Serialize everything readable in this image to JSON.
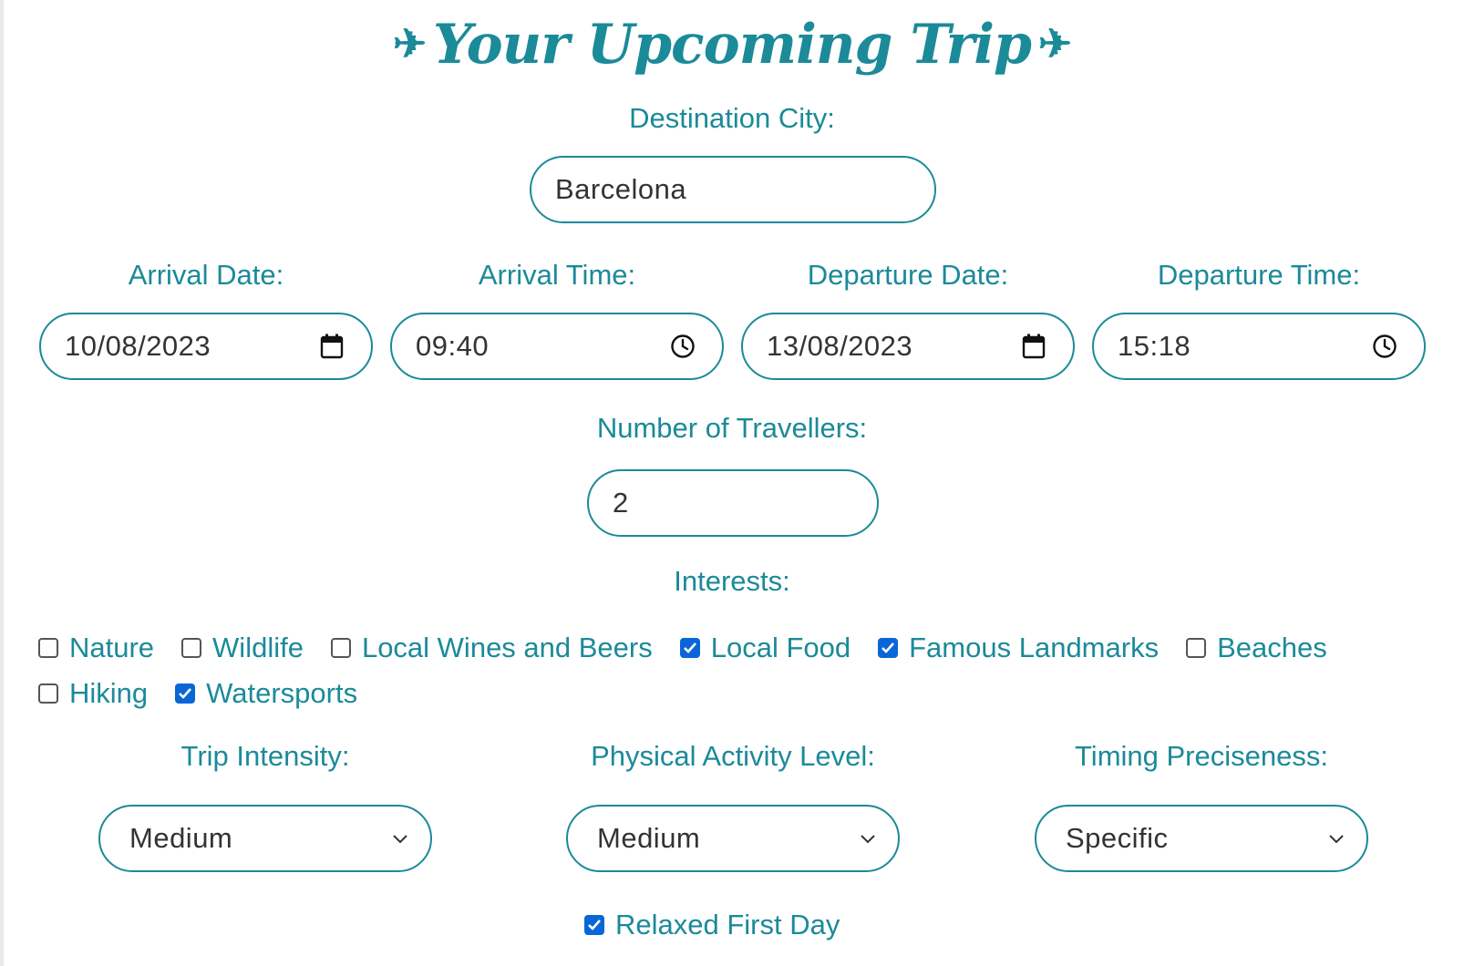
{
  "header": {
    "title": "Your Upcoming Trip",
    "plane_glyph": "✈"
  },
  "destination": {
    "label": "Destination City:",
    "value": "Barcelona"
  },
  "arrival_date": {
    "label": "Arrival Date:",
    "value": "10/08/2023"
  },
  "arrival_time": {
    "label": "Arrival Time:",
    "value": "09:40"
  },
  "departure_date": {
    "label": "Departure Date:",
    "value": "13/08/2023"
  },
  "departure_time": {
    "label": "Departure Time:",
    "value": "15:18"
  },
  "travellers": {
    "label": "Number of Travellers:",
    "value": "2"
  },
  "interests": {
    "label": "Interests:",
    "items": [
      {
        "label": "Nature",
        "checked": false
      },
      {
        "label": "Wildlife",
        "checked": false
      },
      {
        "label": "Local Wines and Beers",
        "checked": false
      },
      {
        "label": "Local Food",
        "checked": true
      },
      {
        "label": "Famous Landmarks",
        "checked": true
      },
      {
        "label": "Beaches",
        "checked": false
      },
      {
        "label": "Hiking",
        "checked": false
      },
      {
        "label": "Watersports",
        "checked": true
      }
    ]
  },
  "trip_intensity": {
    "label": "Trip Intensity:",
    "value": "Medium"
  },
  "physical_activity": {
    "label": "Physical Activity Level:",
    "value": "Medium"
  },
  "timing_preciseness": {
    "label": "Timing Preciseness:",
    "value": "Specific"
  },
  "relaxed_first_day": {
    "label": "Relaxed First Day",
    "checked": true
  },
  "colors": {
    "accent": "#1b8a99",
    "checkbox_checked": "#0a66d6",
    "text": "#333333"
  }
}
